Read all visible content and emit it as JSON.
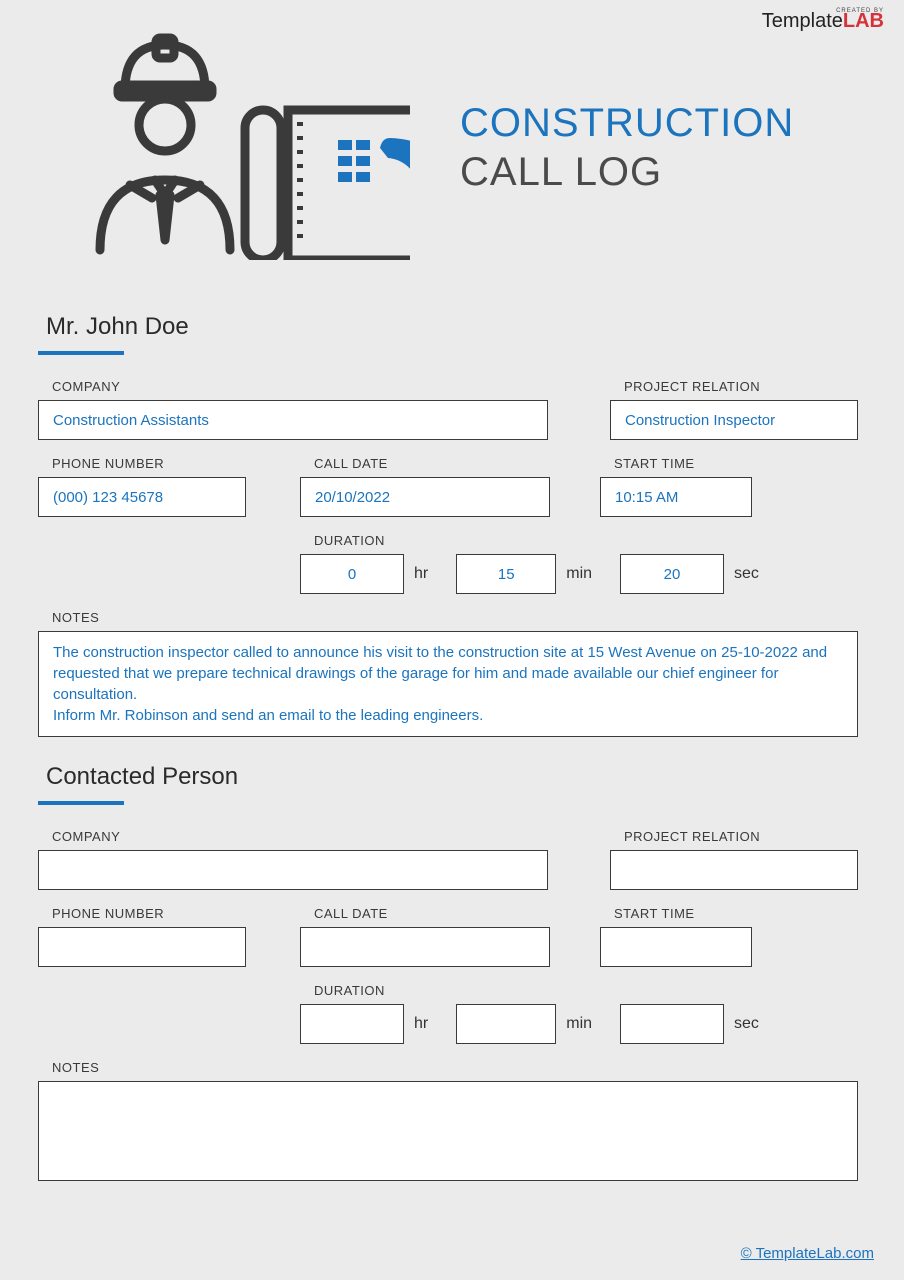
{
  "brand": {
    "created": "CREATED BY",
    "part1": "Template",
    "part2": "LAB"
  },
  "title": {
    "line1": "CONSTRUCTION",
    "line2": "CALL LOG"
  },
  "labels": {
    "company": "COMPANY",
    "project_relation": "PROJECT RELATION",
    "phone": "PHONE NUMBER",
    "call_date": "CALL DATE",
    "start_time": "START TIME",
    "duration": "DURATION",
    "notes": "NOTES",
    "hr": "hr",
    "min": "min",
    "sec": "sec"
  },
  "entry1": {
    "name": "Mr. John Doe",
    "company": "Construction Assistants",
    "project_relation": "Construction Inspector",
    "phone": "(000) 123 45678",
    "call_date": "20/10/2022",
    "start_time": "10:15 AM",
    "duration": {
      "hr": "0",
      "min": "15",
      "sec": "20"
    },
    "notes": "The construction inspector called to announce his visit to the construction site at 15 West Avenue on 25-10-2022 and requested that we prepare technical drawings of the garage for him and made available our chief engineer for consultation.\nInform Mr. Robinson and send an email to the leading engineers."
  },
  "entry2": {
    "name": "Contacted Person",
    "company": "",
    "project_relation": "",
    "phone": "",
    "call_date": "",
    "start_time": "",
    "duration": {
      "hr": "",
      "min": "",
      "sec": ""
    },
    "notes": ""
  },
  "footer": {
    "link": "© TemplateLab.com"
  }
}
